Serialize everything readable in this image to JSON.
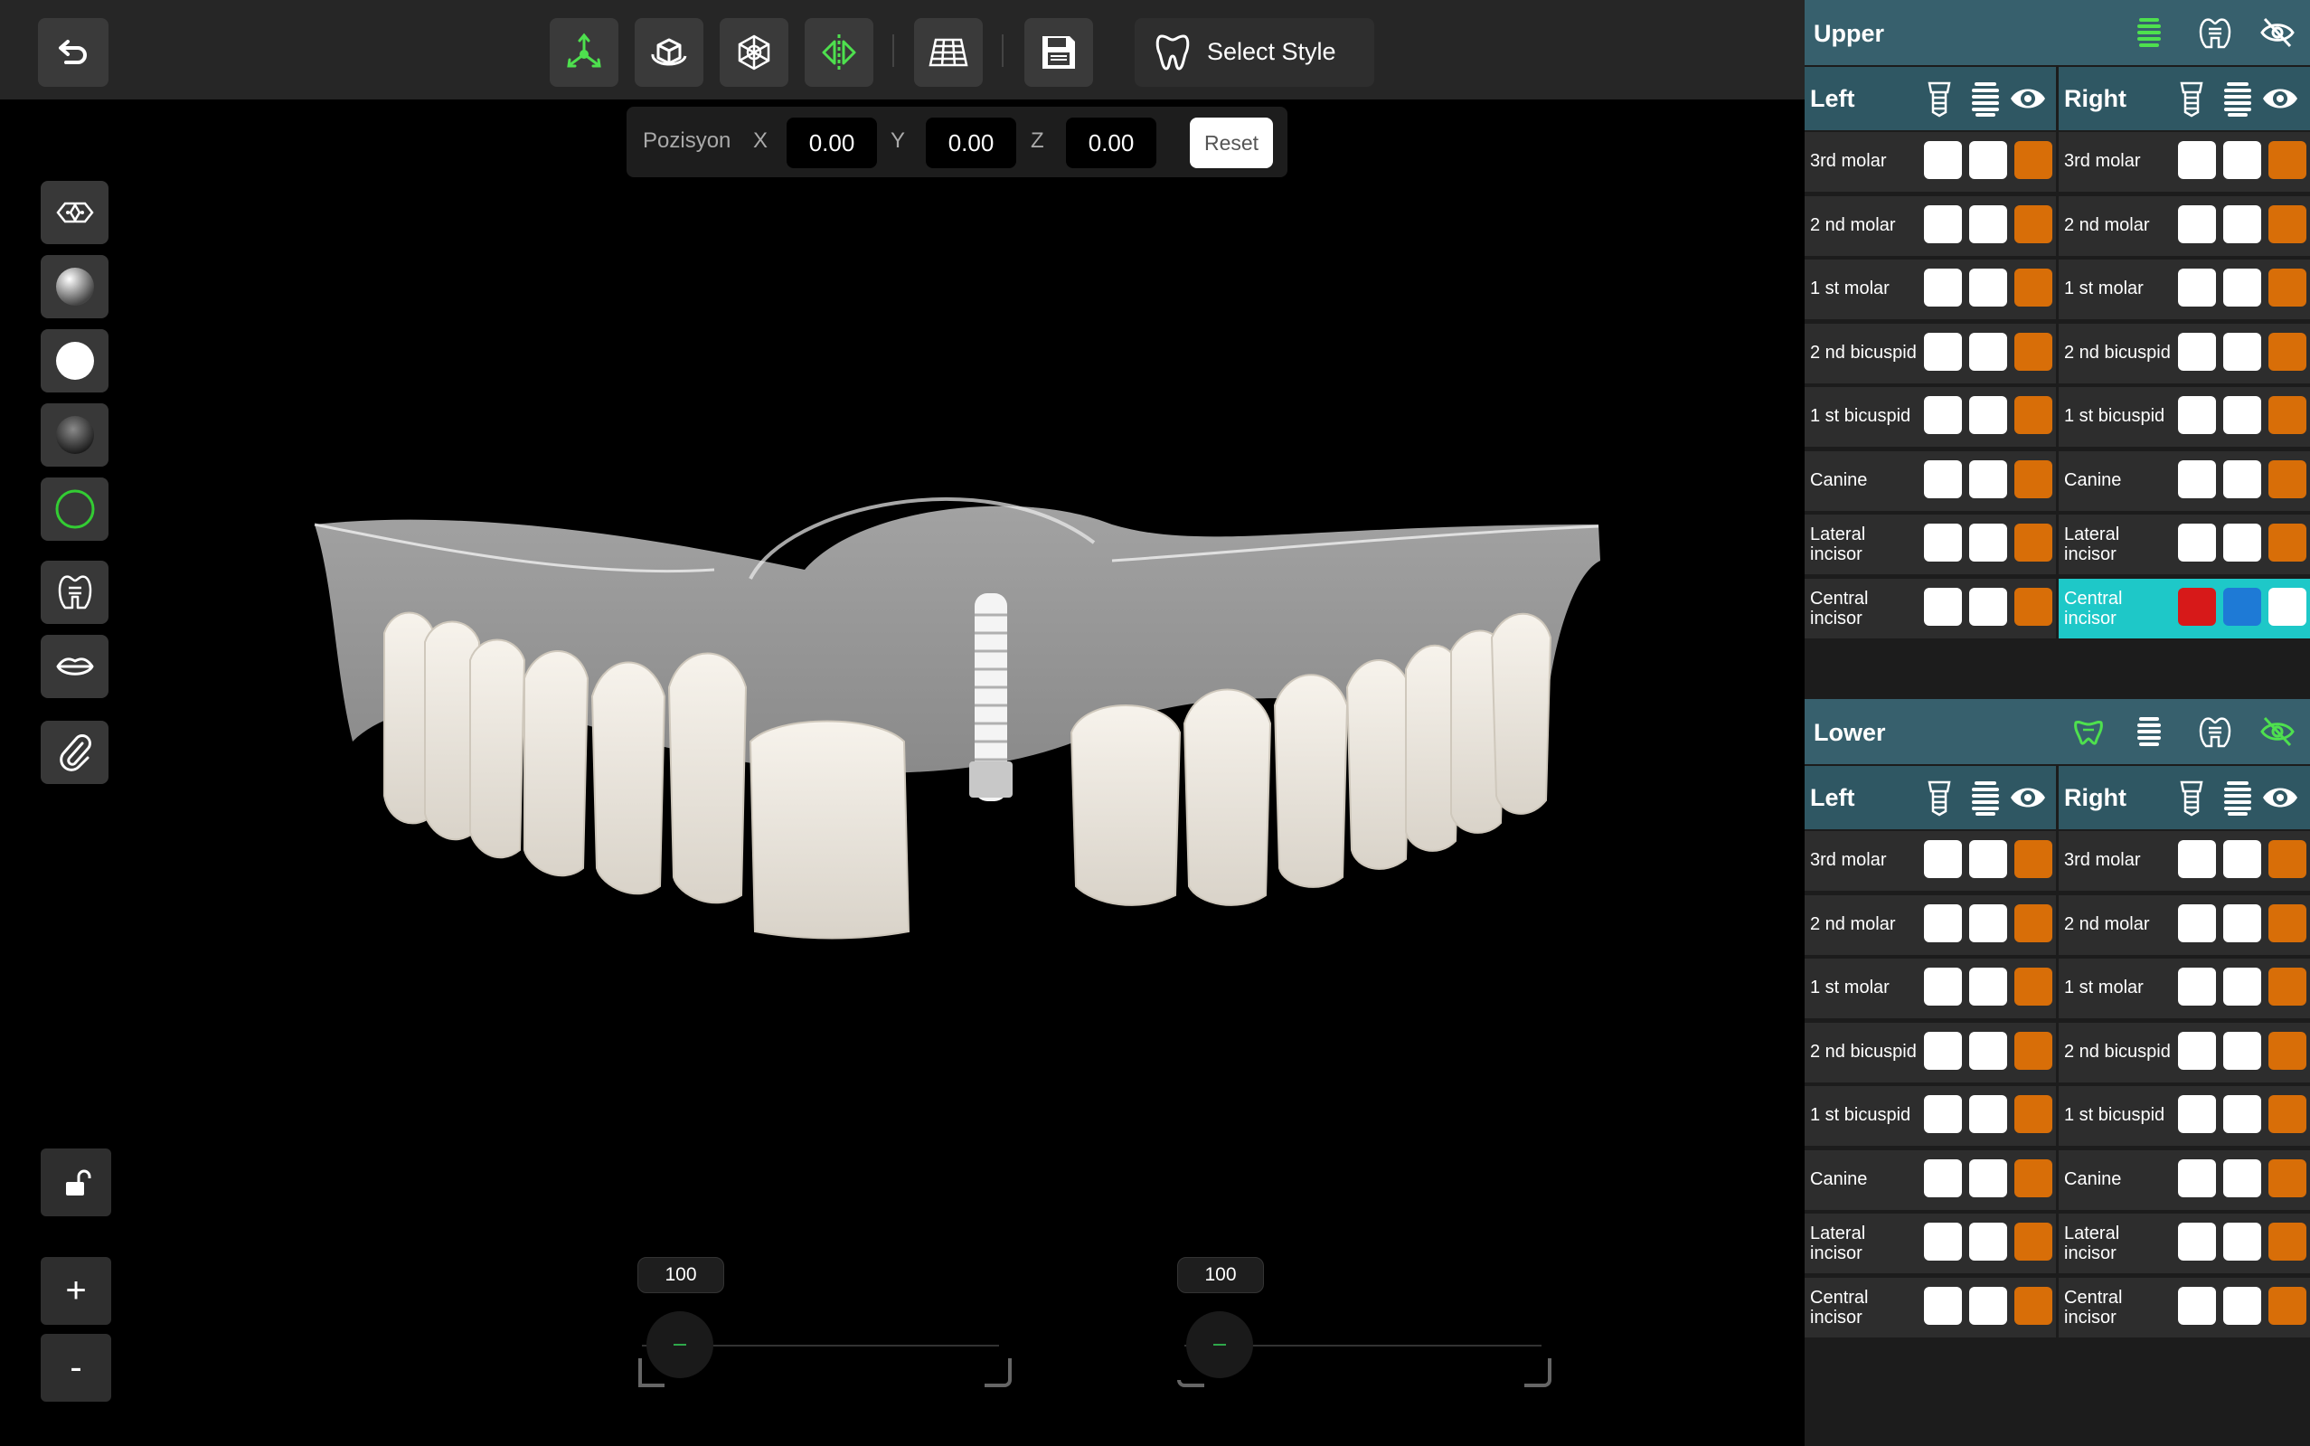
{
  "toolbar": {
    "select_style_label": "Select Style"
  },
  "position": {
    "label": "Pozisyon",
    "x_label": "X",
    "x_value": "0.00",
    "y_label": "Y",
    "y_value": "0.00",
    "z_label": "Z",
    "z_value": "0.00",
    "reset_label": "Reset"
  },
  "zoom": {
    "plus_label": "+",
    "minus_label": "-"
  },
  "sliders": [
    {
      "value_label": "100"
    },
    {
      "value_label": "100"
    }
  ],
  "upper": {
    "title": "Upper",
    "left": {
      "title": "Left",
      "rows": [
        "3rd molar",
        "2 nd  molar",
        "1 st molar",
        "2 nd bicuspid",
        "1 st bicuspid",
        "Canine",
        "Lateral\nincisor",
        "Central\nincisor"
      ]
    },
    "right": {
      "title": "Right",
      "rows": [
        "3rd molar",
        "2 nd  molar",
        "1 st molar",
        "2 nd bicuspid",
        "1 st bicuspid",
        "Canine",
        "Lateral\nincisor",
        "Central\nincisor"
      ],
      "active_row": 7
    }
  },
  "lower": {
    "title": "Lower",
    "left": {
      "title": "Left",
      "rows": [
        "3rd molar",
        "2 nd  molar",
        "1 st molar",
        "2 nd bicuspid",
        "1 st bicuspid",
        "Canine",
        "Lateral\nincisor",
        "Central\nincisor"
      ]
    },
    "right": {
      "title": "Right",
      "rows": [
        "3rd molar",
        "2 nd  molar",
        "1 st molar",
        "2 nd bicuspid",
        "1 st bicuspid",
        "Canine",
        "Lateral\nincisor",
        "Central\nincisor"
      ]
    }
  },
  "colors": {
    "accent_green": "#4ee04e",
    "swatch_orange": "#d86e08",
    "active_row": "#1ec8c8",
    "header_teal": "#37606d"
  },
  "icons": [
    "undo-icon",
    "axis-move-icon",
    "rotate-box-icon",
    "wireframe-icon",
    "mirror-icon",
    "grid-icon",
    "save-icon",
    "tooth-icon",
    "eye-icon",
    "eye-off-icon",
    "implant-icon",
    "lips-icon",
    "clip-icon",
    "lock-open-icon"
  ]
}
